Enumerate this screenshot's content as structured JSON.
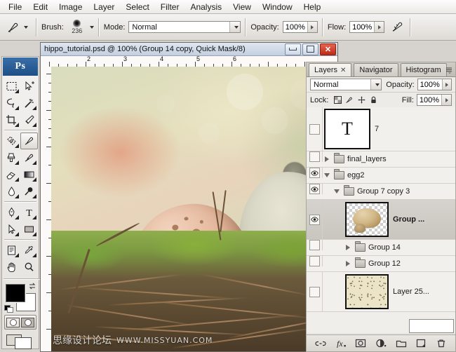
{
  "menubar": {
    "items": [
      {
        "label": "File",
        "name": "menu-file"
      },
      {
        "label": "Edit",
        "name": "menu-edit"
      },
      {
        "label": "Image",
        "name": "menu-image"
      },
      {
        "label": "Layer",
        "name": "menu-layer"
      },
      {
        "label": "Select",
        "name": "menu-select"
      },
      {
        "label": "Filter",
        "name": "menu-filter"
      },
      {
        "label": "Analysis",
        "name": "menu-analysis"
      },
      {
        "label": "View",
        "name": "menu-view"
      },
      {
        "label": "Window",
        "name": "menu-window"
      },
      {
        "label": "Help",
        "name": "menu-help"
      }
    ]
  },
  "options_bar": {
    "tool_icon": "brush-tool-icon",
    "brush_label": "Brush:",
    "brush_size": "236",
    "mode_label": "Mode:",
    "mode_value": "Normal",
    "opacity_label": "Opacity:",
    "opacity_value": "100%",
    "flow_label": "Flow:",
    "flow_value": "100%",
    "airbrush_icon": "airbrush-icon"
  },
  "toolbox": {
    "logo": "Ps",
    "tools": [
      {
        "name": "rectangular-marquee-tool-icon"
      },
      {
        "name": "move-tool-icon"
      },
      {
        "name": "lasso-tool-icon"
      },
      {
        "name": "magic-wand-tool-icon"
      },
      {
        "name": "crop-tool-icon"
      },
      {
        "name": "slice-tool-icon"
      },
      {
        "name": "patch-tool-icon"
      },
      {
        "name": "brush-tool-icon"
      },
      {
        "name": "clone-stamp-tool-icon"
      },
      {
        "name": "history-brush-tool-icon"
      },
      {
        "name": "eraser-tool-icon"
      },
      {
        "name": "gradient-tool-icon"
      },
      {
        "name": "blur-tool-icon"
      },
      {
        "name": "dodge-tool-icon"
      },
      {
        "name": "pen-tool-icon"
      },
      {
        "name": "type-tool-icon"
      },
      {
        "name": "path-selection-tool-icon"
      },
      {
        "name": "rectangle-shape-tool-icon"
      },
      {
        "name": "notes-tool-icon"
      },
      {
        "name": "eyedropper-tool-icon"
      },
      {
        "name": "hand-tool-icon"
      },
      {
        "name": "zoom-tool-icon"
      }
    ],
    "foreground_color": "#000000",
    "background_color": "#ffffff",
    "quick_mask_icon": "quick-mask-mode-icon",
    "screen_mode_icon": "screen-mode-icon"
  },
  "document": {
    "title": "hippo_tutorial.psd @ 100% (Group 14 copy, Quick Mask/8)",
    "minimize_icon": "minimize-icon",
    "restore_icon": "restore-icon",
    "close_icon": "close-icon",
    "ruler_ticks": [
      "2",
      "3",
      "4",
      "5",
      "6"
    ],
    "watermark_cn": "思缘设计论坛",
    "watermark_url": "WWW.MISSYUAN.COM"
  },
  "layers_panel": {
    "tabs": [
      {
        "label": "Layers",
        "active": true,
        "closable": true
      },
      {
        "label": "Navigator",
        "active": false,
        "closable": false
      },
      {
        "label": "Histogram",
        "active": false,
        "closable": false
      }
    ],
    "panel_menu_icon": "panel-menu-icon",
    "blend_mode": "Normal",
    "opacity_label": "Opacity:",
    "opacity_value": "100%",
    "lock_label": "Lock:",
    "lock_icons": [
      "lock-transparent-pixels-icon",
      "lock-image-pixels-icon",
      "lock-position-icon",
      "lock-all-icon"
    ],
    "fill_label": "Fill:",
    "fill_value": "100%",
    "layers": [
      {
        "name": "7",
        "type": "text",
        "visible": false,
        "indent": 0,
        "selected": false,
        "thumb": "text-T",
        "expanded": null
      },
      {
        "name": "final_layers",
        "type": "group",
        "visible": false,
        "indent": 0,
        "selected": false,
        "thumb": "folder",
        "expanded": false
      },
      {
        "name": "egg2",
        "type": "group",
        "visible": true,
        "indent": 0,
        "selected": false,
        "thumb": "folder",
        "expanded": true
      },
      {
        "name": "Group 7 copy 3",
        "type": "group",
        "visible": true,
        "indent": 1,
        "selected": false,
        "thumb": "folder",
        "expanded": true
      },
      {
        "name": "Group ...",
        "type": "layer",
        "visible": true,
        "indent": 2,
        "selected": true,
        "thumb": "animal",
        "expanded": null
      },
      {
        "name": "Group 14",
        "type": "group",
        "visible": false,
        "indent": 2,
        "selected": false,
        "thumb": "folder",
        "expanded": false
      },
      {
        "name": "Group 12",
        "type": "group",
        "visible": false,
        "indent": 2,
        "selected": false,
        "thumb": "folder",
        "expanded": false
      },
      {
        "name": "Layer 25...",
        "type": "layer",
        "visible": false,
        "indent": 2,
        "selected": false,
        "thumb": "texture",
        "expanded": null
      }
    ],
    "bottom_buttons": [
      {
        "name": "link-layers-button",
        "icon": "link-icon"
      },
      {
        "name": "layer-style-button",
        "icon": "fx-icon"
      },
      {
        "name": "layer-mask-button",
        "icon": "mask-icon"
      },
      {
        "name": "adjustment-layer-button",
        "icon": "half-circle-icon"
      },
      {
        "name": "new-group-button",
        "icon": "folder-icon"
      },
      {
        "name": "new-layer-button",
        "icon": "new-layer-icon"
      },
      {
        "name": "delete-layer-button",
        "icon": "trash-icon"
      }
    ]
  },
  "colors": {
    "accent_blue": "#1e4f86",
    "close_red": "#bb2a16",
    "selection": "#c9c6c0"
  }
}
